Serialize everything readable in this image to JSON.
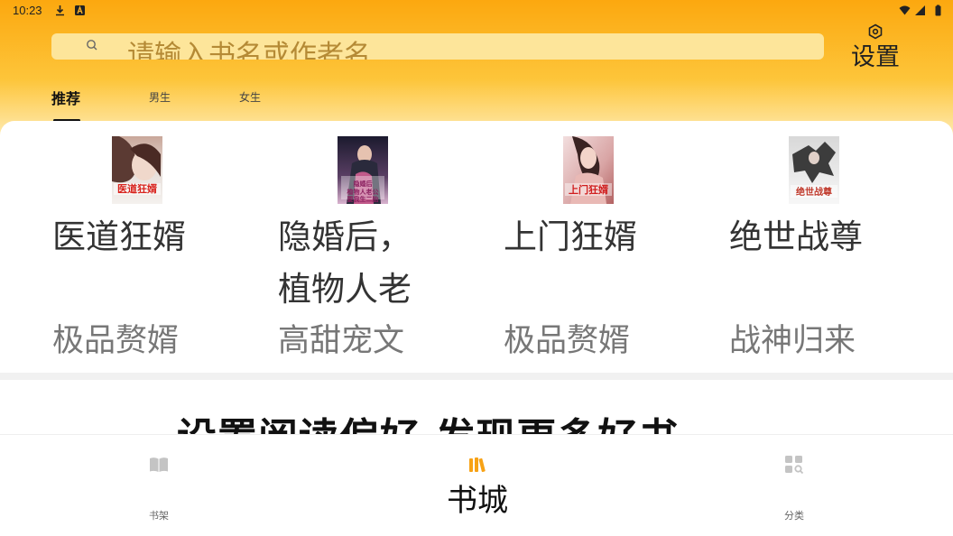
{
  "status_bar": {
    "time": "10:23",
    "icons": [
      "download-icon",
      "a-notification-icon",
      "wifi-icon",
      "signal-icon",
      "battery-icon"
    ]
  },
  "search": {
    "placeholder": "请输入书名或作者名"
  },
  "settings": {
    "label": "设置",
    "icon": "settings-icon"
  },
  "tabs": [
    {
      "label": "推荐",
      "selected": true
    },
    {
      "label": "男生",
      "selected": false
    },
    {
      "label": "女生",
      "selected": false
    }
  ],
  "books": [
    {
      "title": "医道狂婿",
      "genre": "极品赘婿",
      "cover_text": "医道狂婿"
    },
    {
      "title": "隐婚后，植物人老",
      "genre": "高甜宠文",
      "cover_text": "隐婚后植物人老公要我生二胎"
    },
    {
      "title": "上门狂婿",
      "genre": "极品赘婿",
      "cover_text": "上门狂婿"
    },
    {
      "title": "绝世战尊",
      "genre": "战神归来",
      "cover_text": "绝世战尊"
    }
  ],
  "banner": {
    "text": "设置阅读偏好   发现更多好书"
  },
  "bottom_nav": [
    {
      "label": "书架",
      "icon": "book-open-icon",
      "selected": false
    },
    {
      "label": "书城",
      "icon": "bookstore-icon",
      "selected": true
    },
    {
      "label": "分类",
      "icon": "category-grid-icon",
      "selected": false
    }
  ],
  "colors": {
    "header_top": "#fca80f",
    "header_mid": "#fdc53a",
    "search_bg": "#fde59a",
    "accent_orange": "#f7a215"
  }
}
